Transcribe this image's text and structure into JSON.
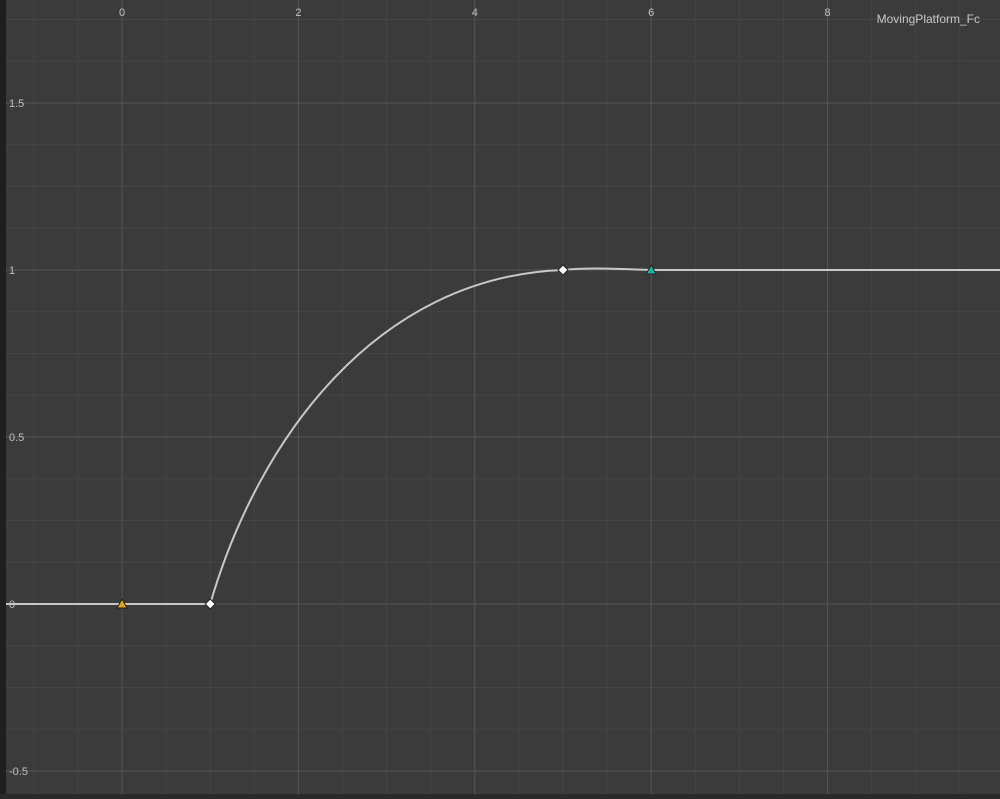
{
  "curve_name": "MovingPlatform_Fc",
  "x_axis": {
    "tick_labels": [
      "0",
      "2",
      "4",
      "6",
      "8"
    ],
    "tick_values": [
      0,
      2,
      4,
      6,
      8
    ],
    "range": [
      -1.3,
      9.9
    ]
  },
  "y_axis": {
    "tick_labels": [
      "1.5",
      "1",
      "0.5",
      "0",
      "-0.5"
    ],
    "tick_values": [
      1.5,
      1,
      0.5,
      0,
      -0.5
    ],
    "range": [
      -0.56,
      1.81
    ]
  },
  "colors": {
    "background": "#3b3b3b",
    "grid_major": "#555555",
    "grid_minor": "#444444",
    "curve": "#c8c8c8",
    "key_marker": "#ffffff",
    "start_marker": "#e0a020",
    "end_marker": "#20b0a0"
  },
  "keys": [
    {
      "x": 0,
      "y": 0,
      "type": "range-start-triangle"
    },
    {
      "x": 1,
      "y": 0,
      "type": "key-diamond"
    },
    {
      "x": 5,
      "y": 1,
      "type": "key-diamond"
    },
    {
      "x": 6,
      "y": 1,
      "type": "range-end-triangle"
    }
  ]
}
